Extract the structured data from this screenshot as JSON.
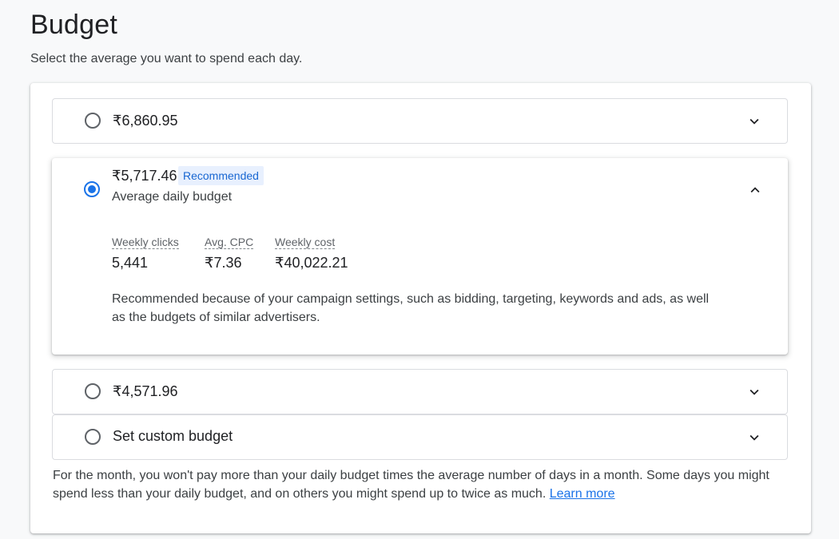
{
  "header": {
    "title": "Budget",
    "subtitle": "Select the average you want to spend each day."
  },
  "options": [
    {
      "amount": "₹6,860.95",
      "selected": false,
      "expanded": false
    },
    {
      "amount": "₹5,717.46",
      "badge": "Recommended",
      "sublabel": "Average daily budget",
      "selected": true,
      "expanded": true,
      "stats": [
        {
          "label": "Weekly clicks",
          "value": "5,441"
        },
        {
          "label": "Avg. CPC",
          "value": "₹7.36"
        },
        {
          "label": "Weekly cost",
          "value": "₹40,022.21"
        }
      ],
      "reason": "Recommended because of your campaign settings, such as bidding, targeting, keywords and ads, as well as the budgets of similar advertisers."
    },
    {
      "amount": "₹4,571.96",
      "selected": false,
      "expanded": false
    },
    {
      "amount": "Set custom budget",
      "selected": false,
      "expanded": false
    }
  ],
  "footer": {
    "text": "For the month, you won't pay more than your daily budget times the average number of days in a month. Some days you might spend less than your daily budget, and on others you might spend up to twice as much.",
    "link": "Learn more"
  },
  "icons": {
    "collapsed": "chevron-down-icon",
    "expanded": "chevron-up-icon"
  },
  "colors": {
    "accent": "#1a73e8",
    "badge_bg": "#e8f0fe"
  }
}
